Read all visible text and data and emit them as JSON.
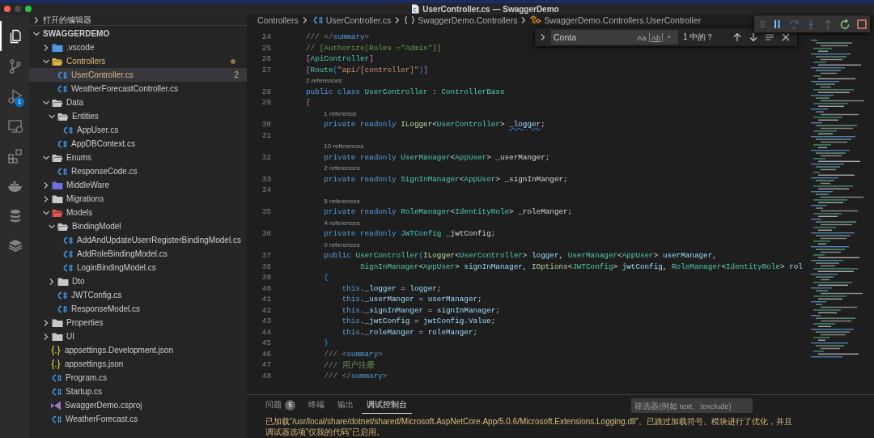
{
  "window": {
    "title": "UserController.cs — SwaggerDemo"
  },
  "activity_bar": [
    {
      "selected": true
    },
    {
      "selected": false
    },
    {
      "selected": false,
      "badge": "1"
    },
    {
      "selected": false
    },
    {
      "selected": false
    },
    {
      "selected": false
    },
    {
      "selected": false
    },
    {
      "selected": false
    }
  ],
  "sidebar": {
    "sections": [
      {
        "title": "打开的编辑器",
        "expanded": false
      },
      {
        "title": "SWAGGERDEMO",
        "expanded": true
      }
    ],
    "tree": [
      {
        "label": ".vscode",
        "kind": "folder",
        "color": "#4b9be0",
        "expanded": false,
        "selected": false,
        "modified": false
      },
      {
        "label": "Controllers",
        "kind": "folder",
        "color": "#e0b43a",
        "expanded": true,
        "selected": false,
        "modified": true,
        "children": [
          {
            "label": "UserController.cs",
            "kind": "csharp",
            "selected": true,
            "modified": true,
            "count": "2"
          },
          {
            "label": "WeatherForecastController.cs",
            "kind": "csharp",
            "selected": false,
            "modified": false
          }
        ]
      },
      {
        "label": "Data",
        "kind": "folder",
        "color": "#c8c8c8",
        "expanded": true,
        "selected": false,
        "modified": false,
        "children": [
          {
            "label": "Entities",
            "kind": "folder",
            "color": "#c8c8c8",
            "expanded": true,
            "selected": false,
            "modified": false,
            "children": [
              {
                "label": "AppUser.cs",
                "kind": "csharp",
                "selected": false,
                "modified": false
              }
            ]
          },
          {
            "label": "AppDBContext.cs",
            "kind": "csharp",
            "selected": false,
            "modified": false
          }
        ]
      },
      {
        "label": "Enums",
        "kind": "folder",
        "color": "#c8c8c8",
        "expanded": true,
        "selected": false,
        "modified": false,
        "children": [
          {
            "label": "ResponseCode.cs",
            "kind": "csharp",
            "selected": false,
            "modified": false
          }
        ]
      },
      {
        "label": "MiddleWare",
        "kind": "folder",
        "color": "#6b6fe0",
        "expanded": false,
        "selected": false,
        "modified": false
      },
      {
        "label": "Migrations",
        "kind": "folder",
        "color": "#c8c8c8",
        "expanded": false,
        "selected": false,
        "modified": false
      },
      {
        "label": "Models",
        "kind": "folder",
        "color": "#e05555",
        "expanded": true,
        "selected": false,
        "modified": false,
        "children": [
          {
            "label": "BindingModel",
            "kind": "folder",
            "color": "#c8c8c8",
            "expanded": true,
            "selected": false,
            "modified": false,
            "children": [
              {
                "label": "AddAndUpdateUserrRegisterBindingModel.cs",
                "kind": "csharp",
                "selected": false,
                "modified": false
              },
              {
                "label": "AddRoleBindingModel.cs",
                "kind": "csharp",
                "selected": false,
                "modified": false
              },
              {
                "label": "LoginBindingModel.cs",
                "kind": "csharp",
                "selected": false,
                "modified": false
              }
            ]
          },
          {
            "label": "Dto",
            "kind": "folder",
            "color": "#c8c8c8",
            "expanded": false,
            "selected": false,
            "modified": false
          },
          {
            "label": "JWTConfig.cs",
            "kind": "csharp",
            "selected": false,
            "modified": false
          },
          {
            "label": "ResponseModel.cs",
            "kind": "csharp",
            "selected": false,
            "modified": false
          }
        ]
      },
      {
        "label": "Properties",
        "kind": "folder",
        "color": "#c8c8c8",
        "expanded": false,
        "selected": false,
        "modified": false
      },
      {
        "label": "UI",
        "kind": "folder",
        "color": "#c8c8c8",
        "expanded": false,
        "selected": false,
        "modified": false
      },
      {
        "label": "appsettings.Development.json",
        "kind": "json",
        "selected": false,
        "modified": false
      },
      {
        "label": "appsettings.json",
        "kind": "json",
        "selected": false,
        "modified": false
      },
      {
        "label": "Program.cs",
        "kind": "csharp",
        "selected": false,
        "modified": false
      },
      {
        "label": "Startup.cs",
        "kind": "csharp",
        "selected": false,
        "modified": false
      },
      {
        "label": "SwaggerDemo.csproj",
        "kind": "csproj",
        "selected": false,
        "modified": false
      },
      {
        "label": "WeatherForecast.cs",
        "kind": "csharp",
        "selected": false,
        "modified": false
      }
    ]
  },
  "breadcrumb": [
    {
      "label": "Controllers",
      "kind": "folder"
    },
    {
      "label": "UserController.cs",
      "kind": "csharp"
    },
    {
      "label": "SwaggerDemo.Controllers",
      "kind": "namespace"
    },
    {
      "label": "SwaggerDemo.Controllers.UserController",
      "kind": "class"
    }
  ],
  "code": [
    {
      "kind": "code",
      "number": "24",
      "tokens": [
        {
          "kind": "doc",
          "text": "/// </"
        },
        {
          "kind": "tag",
          "text": "summary"
        },
        {
          "kind": "doc",
          "text": ">"
        }
      ]
    },
    {
      "kind": "code",
      "number": "25",
      "tokens": [
        {
          "kind": "cmt",
          "text": "// [Authorize(Roles =\"Admin\")]"
        }
      ]
    },
    {
      "kind": "code",
      "number": "26",
      "tokens": [
        {
          "kind": "b1",
          "text": "["
        },
        {
          "kind": "type",
          "text": "ApiController"
        },
        {
          "kind": "b1",
          "text": "]"
        }
      ]
    },
    {
      "kind": "code",
      "number": "27",
      "tokens": [
        {
          "kind": "b1",
          "text": "["
        },
        {
          "kind": "type",
          "text": "Route"
        },
        {
          "kind": "b2",
          "text": "("
        },
        {
          "kind": "str",
          "text": "\"api/[controller]\""
        },
        {
          "kind": "b2",
          "text": ")"
        },
        {
          "kind": "b1",
          "text": "]"
        }
      ]
    },
    {
      "kind": "lens",
      "text": "2 references"
    },
    {
      "kind": "code",
      "number": "28",
      "tokens": [
        {
          "kind": "kw",
          "text": "public class "
        },
        {
          "kind": "type",
          "text": "UserController"
        },
        {
          "kind": "plain",
          "text": " : "
        },
        {
          "kind": "type",
          "text": "ControllerBase"
        }
      ]
    },
    {
      "kind": "code",
      "number": "29",
      "tokens": [
        {
          "kind": "b1",
          "text": "{"
        }
      ]
    },
    {
      "kind": "lens",
      "text": "1 reference"
    },
    {
      "kind": "code",
      "number": "30",
      "tokens": [
        {
          "kind": "kw",
          "text": "    private readonly "
        },
        {
          "kind": "iface",
          "text": "ILogger"
        },
        {
          "kind": "plain",
          "text": "<"
        },
        {
          "kind": "type",
          "text": "UserController"
        },
        {
          "kind": "plain",
          "text": "> "
        },
        {
          "kind": "warn",
          "text": "_logger"
        },
        {
          "kind": "plain",
          "text": ";"
        }
      ]
    },
    {
      "kind": "code",
      "number": "31"
    },
    {
      "kind": "lens",
      "text": "10 references"
    },
    {
      "kind": "code",
      "number": "32",
      "tokens": [
        {
          "kind": "kw",
          "text": "    private readonly "
        },
        {
          "kind": "type",
          "text": "UserManager"
        },
        {
          "kind": "plain",
          "text": "<"
        },
        {
          "kind": "type",
          "text": "AppUser"
        },
        {
          "kind": "plain",
          "text": "> _userManger;"
        }
      ]
    },
    {
      "kind": "lens",
      "text": "2 references"
    },
    {
      "kind": "code",
      "number": "33",
      "tokens": [
        {
          "kind": "kw",
          "text": "    private readonly "
        },
        {
          "kind": "type",
          "text": "SignInManager"
        },
        {
          "kind": "plain",
          "text": "<"
        },
        {
          "kind": "type",
          "text": "AppUser"
        },
        {
          "kind": "plain",
          "text": "> _signInManger;"
        }
      ]
    },
    {
      "kind": "code",
      "number": "34"
    },
    {
      "kind": "lens",
      "text": "5 references"
    },
    {
      "kind": "code",
      "number": "35",
      "tokens": [
        {
          "kind": "kw",
          "text": "    private readonly "
        },
        {
          "kind": "type",
          "text": "RoleManager"
        },
        {
          "kind": "plain",
          "text": "<"
        },
        {
          "kind": "type",
          "text": "IdentityRole"
        },
        {
          "kind": "plain",
          "text": "> _roleManger;"
        }
      ]
    },
    {
      "kind": "lens",
      "text": "4 references"
    },
    {
      "kind": "code",
      "number": "36",
      "tokens": [
        {
          "kind": "kw",
          "text": "    private readonly "
        },
        {
          "kind": "type",
          "text": "JWTConfig"
        },
        {
          "kind": "plain",
          "text": " _jwtConfig;"
        }
      ]
    },
    {
      "kind": "lens",
      "text": "0 references"
    },
    {
      "kind": "code",
      "number": "37",
      "tokens": [
        {
          "kind": "kw",
          "text": "    public "
        },
        {
          "kind": "type",
          "text": "UserController"
        },
        {
          "kind": "b2",
          "text": "("
        },
        {
          "kind": "iface",
          "text": "ILogger"
        },
        {
          "kind": "plain",
          "text": "<"
        },
        {
          "kind": "type",
          "text": "UserController"
        },
        {
          "kind": "plain",
          "text": "> "
        },
        {
          "kind": "var",
          "text": "logger"
        },
        {
          "kind": "plain",
          "text": ", "
        },
        {
          "kind": "type",
          "text": "UserManager"
        },
        {
          "kind": "plain",
          "text": "<"
        },
        {
          "kind": "type",
          "text": "AppUser"
        },
        {
          "kind": "plain",
          "text": "> "
        },
        {
          "kind": "var",
          "text": "userManager"
        },
        {
          "kind": "plain",
          "text": ","
        }
      ]
    },
    {
      "kind": "code",
      "number": "38",
      "tokens": [
        {
          "kind": "type",
          "text": "            SignInManager"
        },
        {
          "kind": "plain",
          "text": "<"
        },
        {
          "kind": "type",
          "text": "AppUser"
        },
        {
          "kind": "plain",
          "text": "> "
        },
        {
          "kind": "var",
          "text": "signInManager"
        },
        {
          "kind": "plain",
          "text": ", "
        },
        {
          "kind": "iface",
          "text": "IOptions"
        },
        {
          "kind": "plain",
          "text": "<"
        },
        {
          "kind": "type",
          "text": "JWTConfig"
        },
        {
          "kind": "plain",
          "text": "> "
        },
        {
          "kind": "var",
          "text": "jwtConfig"
        },
        {
          "kind": "plain",
          "text": ", "
        },
        {
          "kind": "type",
          "text": "RoleManager"
        },
        {
          "kind": "plain",
          "text": "<"
        },
        {
          "kind": "type",
          "text": "IdentityRole"
        },
        {
          "kind": "plain",
          "text": "> "
        },
        {
          "kind": "var",
          "text": "rol"
        }
      ]
    },
    {
      "kind": "code",
      "number": "39",
      "tokens": [
        {
          "kind": "b2",
          "text": "    {"
        }
      ]
    },
    {
      "kind": "code",
      "number": "40",
      "tokens": [
        {
          "kind": "kw",
          "text": "        this"
        },
        {
          "kind": "plain",
          "text": "."
        },
        {
          "kind": "var",
          "text": "_logger"
        },
        {
          "kind": "plain",
          "text": " = "
        },
        {
          "kind": "var",
          "text": "logger"
        },
        {
          "kind": "plain",
          "text": ";"
        }
      ]
    },
    {
      "kind": "code",
      "number": "41",
      "tokens": [
        {
          "kind": "kw",
          "text": "        this"
        },
        {
          "kind": "plain",
          "text": "."
        },
        {
          "kind": "var",
          "text": "_userManger"
        },
        {
          "kind": "plain",
          "text": " = "
        },
        {
          "kind": "var",
          "text": "userManager"
        },
        {
          "kind": "plain",
          "text": ";"
        }
      ]
    },
    {
      "kind": "code",
      "number": "42",
      "tokens": [
        {
          "kind": "kw",
          "text": "        this"
        },
        {
          "kind": "plain",
          "text": "."
        },
        {
          "kind": "var",
          "text": "_signInManger"
        },
        {
          "kind": "plain",
          "text": " = "
        },
        {
          "kind": "var",
          "text": "signInManager"
        },
        {
          "kind": "plain",
          "text": ";"
        }
      ]
    },
    {
      "kind": "code",
      "number": "43",
      "tokens": [
        {
          "kind": "kw",
          "text": "        this"
        },
        {
          "kind": "plain",
          "text": "."
        },
        {
          "kind": "var",
          "text": "_jwtConfig"
        },
        {
          "kind": "plain",
          "text": " = "
        },
        {
          "kind": "var",
          "text": "jwtConfig"
        },
        {
          "kind": "plain",
          "text": "."
        },
        {
          "kind": "var",
          "text": "Value"
        },
        {
          "kind": "plain",
          "text": ";"
        }
      ]
    },
    {
      "kind": "code",
      "number": "44",
      "tokens": [
        {
          "kind": "kw",
          "text": "        this"
        },
        {
          "kind": "plain",
          "text": "."
        },
        {
          "kind": "var",
          "text": "_roleManger"
        },
        {
          "kind": "plain",
          "text": " = "
        },
        {
          "kind": "var",
          "text": "roleManger"
        },
        {
          "kind": "plain",
          "text": ";"
        }
      ]
    },
    {
      "kind": "code",
      "number": "45",
      "tokens": [
        {
          "kind": "b2",
          "text": "    }"
        }
      ]
    },
    {
      "kind": "code",
      "number": "46",
      "tokens": [
        {
          "kind": "doc",
          "text": "    /// <"
        },
        {
          "kind": "tag",
          "text": "summary"
        },
        {
          "kind": "doc",
          "text": ">"
        }
      ]
    },
    {
      "kind": "code",
      "number": "47",
      "tokens": [
        {
          "kind": "doc",
          "text": "    /// "
        },
        {
          "kind": "cmt",
          "text": "用户注册"
        }
      ]
    },
    {
      "kind": "code",
      "number": "48",
      "tokens": [
        {
          "kind": "doc",
          "text": "    /// </"
        },
        {
          "kind": "tag",
          "text": "summary"
        },
        {
          "kind": "doc",
          "text": ">"
        }
      ]
    }
  ],
  "find_widget": {
    "expanded": false,
    "value": "Conta",
    "toggles": [
      "Aa",
      "Ab",
      ".*"
    ],
    "result": "1 中的？"
  },
  "debug_toolbar": {
    "buttons": [
      {
        "disabled": false
      },
      {
        "disabled": true
      },
      {
        "disabled": true
      },
      {
        "disabled": true
      },
      {
        "disabled": false
      },
      {
        "disabled": false
      }
    ]
  },
  "panel": {
    "tabs": [
      {
        "label": "问题",
        "selected": false,
        "badge": "5"
      },
      {
        "label": "终端",
        "selected": false
      },
      {
        "label": "输出",
        "selected": false
      },
      {
        "label": "调试控制台",
        "selected": true
      }
    ],
    "filter": {
      "placeholder": "筛选器(例如 text、!exclude)"
    },
    "output": [
      "已加载“/usr/local/share/dotnet/shared/Microsoft.AspNetCore.App/5.0.6/Microsoft.Extensions.Logging.dll”。已跳过加载符号。模块进行了优化，并且",
      "调试器选项“仅我的代码”已启用。"
    ]
  }
}
